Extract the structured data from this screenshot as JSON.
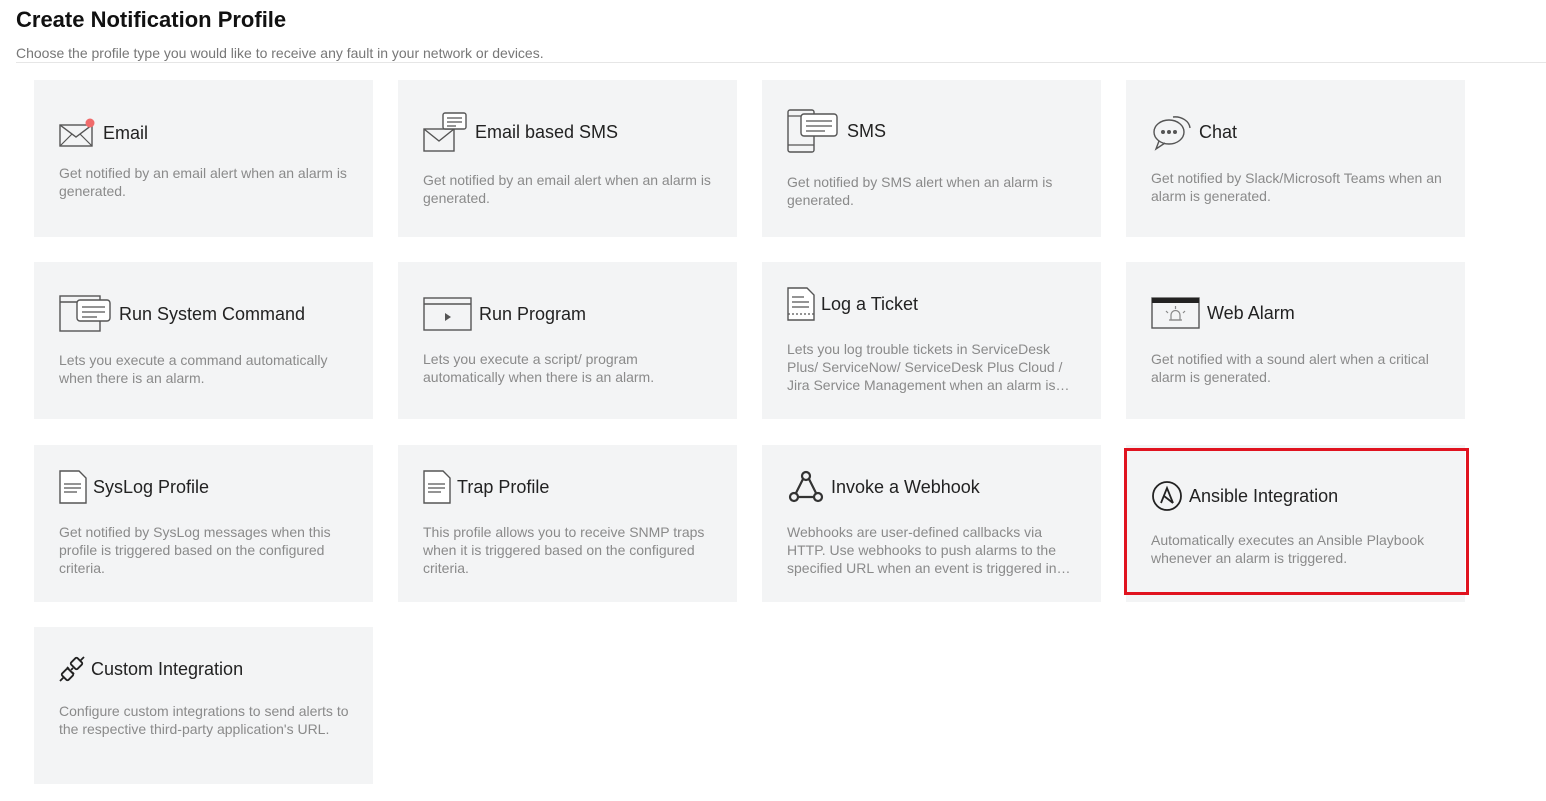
{
  "header": {
    "title": "Create Notification Profile",
    "subtitle": "Choose the profile type you would like to receive any fault in your network or devices."
  },
  "profiles": [
    {
      "title": "Email",
      "icon": "email-icon",
      "description": "Get notified by an email alert when an alarm is generated."
    },
    {
      "title": "Email based SMS",
      "icon": "email-sms-icon",
      "description": "Get notified by an email alert when an alarm is generated."
    },
    {
      "title": "SMS",
      "icon": "sms-icon",
      "description": "Get notified by SMS alert when an alarm is generated."
    },
    {
      "title": "Chat",
      "icon": "chat-icon",
      "description": "Get notified by Slack/Microsoft Teams when an alarm is generated."
    },
    {
      "title": "Run System Command",
      "icon": "command-icon",
      "description": "Lets you execute a command automatically when there is an alarm."
    },
    {
      "title": "Run Program",
      "icon": "program-icon",
      "description": "Lets you execute a script/ program automatically when there is an alarm."
    },
    {
      "title": "Log a Ticket",
      "icon": "ticket-icon",
      "description": "Lets you log trouble tickets in ServiceDesk Plus/ ServiceNow/ ServiceDesk Plus Cloud / Jira Service Management when an alarm is generated."
    },
    {
      "title": "Web Alarm",
      "icon": "web-alarm-icon",
      "description": "Get notified with a sound alert when a critical alarm is generated."
    },
    {
      "title": "SysLog Profile",
      "icon": "syslog-icon",
      "description": "Get notified by SysLog messages when this profile is triggered based on the configured criteria."
    },
    {
      "title": "Trap Profile",
      "icon": "trap-icon",
      "description": "This profile allows you to receive SNMP traps when it is triggered based on the configured criteria."
    },
    {
      "title": "Invoke a Webhook",
      "icon": "webhook-icon",
      "description": "Webhooks are user-defined callbacks via HTTP. Use webhooks to push alarms to the specified URL when an event is triggered in the network."
    },
    {
      "title": "Ansible Integration",
      "icon": "ansible-icon",
      "description": "Automatically executes an Ansible Playbook whenever an alarm is triggered."
    },
    {
      "title": "Custom Integration",
      "icon": "custom-integration-icon",
      "description": "Configure custom integrations to send alerts to the respective third-party application's URL."
    }
  ],
  "colors": {
    "card_bg": "#f3f4f5",
    "highlight": "#e0131f",
    "email_badge": "#f06b6b"
  }
}
